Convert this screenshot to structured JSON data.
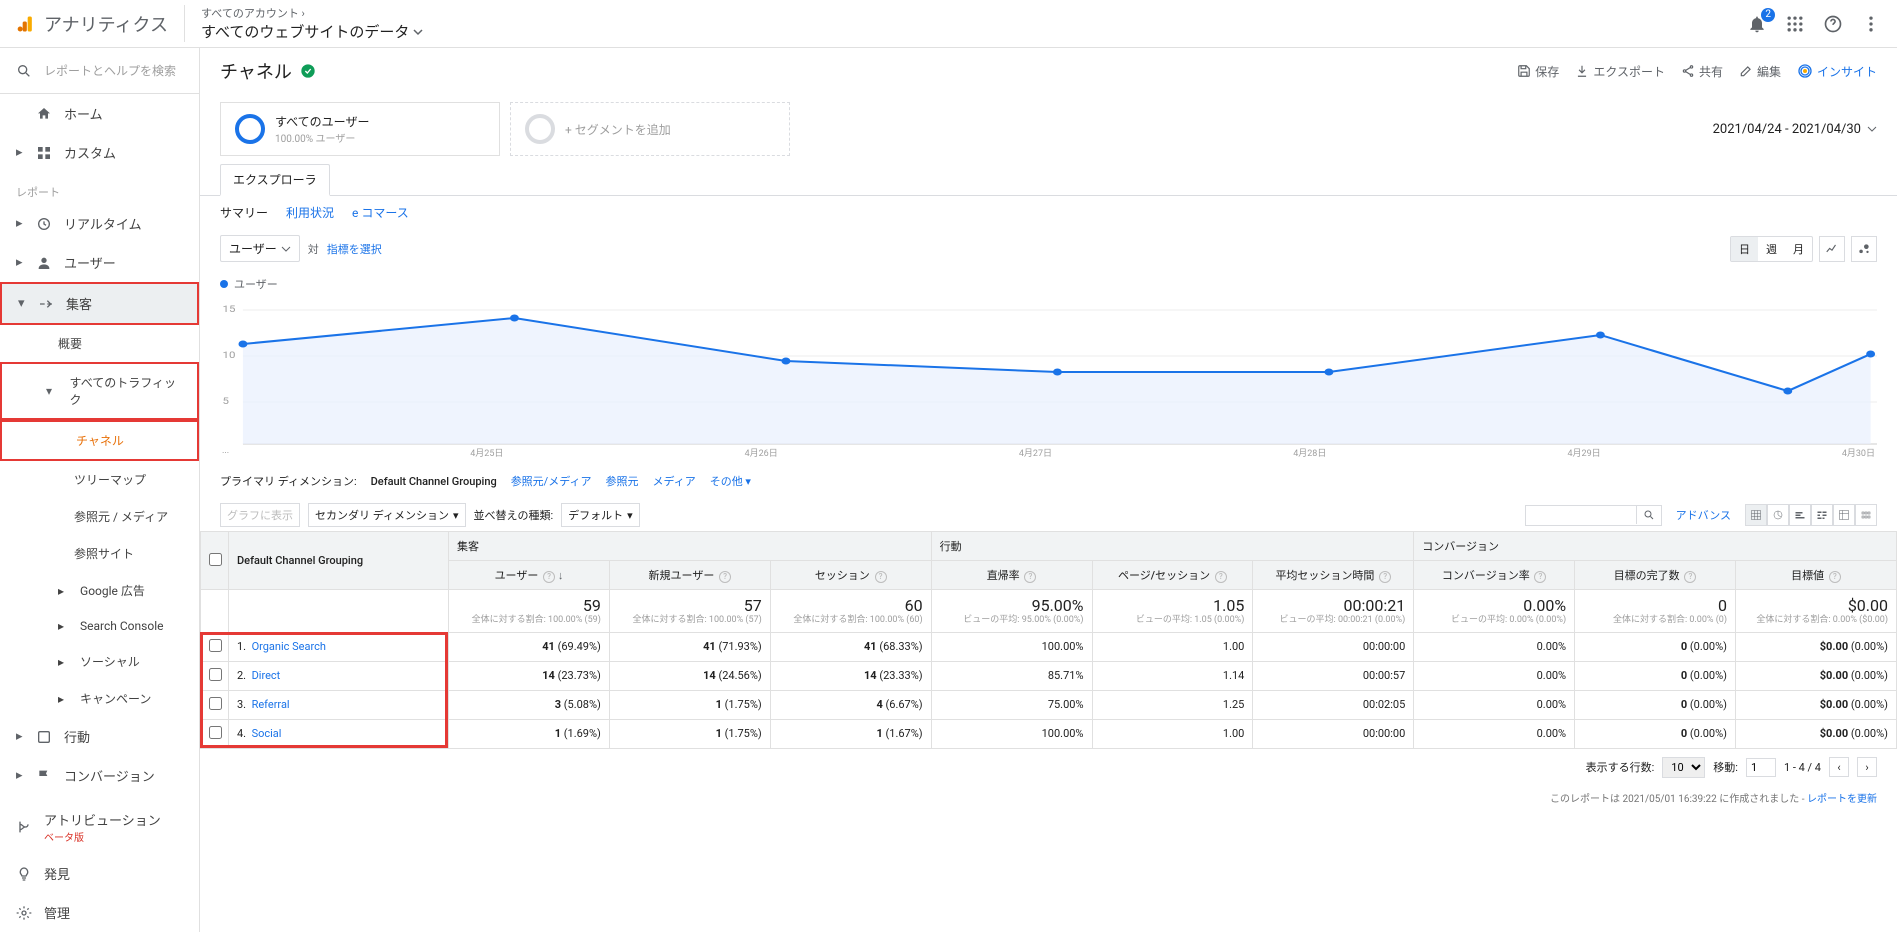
{
  "header": {
    "app_title": "アナリティクス",
    "account_path": "すべてのアカウント",
    "view_name": "すべてのウェブサイトのデータ",
    "badge": "2"
  },
  "sidebar": {
    "search_placeholder": "レポートとヘルプを検索",
    "home": "ホーム",
    "custom": "カスタム",
    "section_reports": "レポート",
    "realtime": "リアルタイム",
    "audience": "ユーザー",
    "acquisition": "集客",
    "acq_overview": "概要",
    "acq_all_traffic": "すべてのトラフィック",
    "channel": "チャネル",
    "treemap": "ツリーマップ",
    "source_medium": "参照元 / メディア",
    "referral": "参照サイト",
    "gads": "Google 広告",
    "sc": "Search Console",
    "social": "ソーシャル",
    "campaign": "キャンペーン",
    "behavior": "行動",
    "conversion": "コンバージョン",
    "attribution": "アトリビューション",
    "beta": "ベータ版",
    "discover": "発見",
    "admin": "管理"
  },
  "report": {
    "title": "チャネル",
    "save": "保存",
    "export": "エクスポート",
    "share": "共有",
    "edit": "編集",
    "insight": "インサイト",
    "seg_all_users": "すべてのユーザー",
    "seg_pct": "100.00% ユーザー",
    "seg_add": "+ セグメントを追加",
    "date_range": "2021/04/24 - 2021/04/30",
    "tab_explorer": "エクスプローラ",
    "subtabs": {
      "summary": "サマリー",
      "usage": "利用状況",
      "ecom": "e コマース"
    },
    "metric_btn": "ユーザー",
    "vs": "対",
    "metric_link": "指標を選択",
    "legend": "ユーザー",
    "time_toggles": {
      "day": "日",
      "week": "週",
      "month": "月"
    },
    "x_axis": [
      "...",
      "4月25日",
      "4月26日",
      "4月27日",
      "4月28日",
      "4月29日",
      "4月30日"
    ],
    "primary_dim_label": "プライマリ ディメンション:",
    "primary_dim_value": "Default Channel Grouping",
    "dim_links": {
      "sm": "参照元/メディア",
      "s": "参照元",
      "m": "メディア",
      "other": "その他"
    },
    "plot_in_chart": "グラフに表示",
    "secondary_dim": "セカンダリ ディメンション",
    "sort_label": "並べ替えの種類:",
    "sort_value": "デフォルト",
    "advanced": "アドバンス"
  },
  "chart_data": {
    "type": "line",
    "x": [
      "4/24",
      "4/25",
      "4/26",
      "4/27",
      "4/28",
      "4/29",
      "4/30"
    ],
    "series": [
      {
        "name": "ユーザー",
        "values": [
          11,
          14,
          9,
          8,
          8,
          12,
          6,
          10
        ]
      }
    ],
    "ylim": [
      0,
      15
    ],
    "y_ticks": [
      5,
      10,
      15
    ]
  },
  "table": {
    "col_group": {
      "dim": "Default Channel Grouping",
      "acq": "集客",
      "beh": "行動",
      "conv": "コンバージョン"
    },
    "cols": {
      "users": "ユーザー",
      "new_users": "新規ユーザー",
      "sessions": "セッション",
      "bounce": "直帰率",
      "pps": "ページ/セッション",
      "avg_dur": "平均セッション時間",
      "cvr": "コンバージョン率",
      "goal_comp": "目標の完了数",
      "goal_val": "目標値"
    },
    "totals": {
      "users": {
        "v": "59",
        "sub": "全体に対する割合: 100.00% (59)"
      },
      "new_users": {
        "v": "57",
        "sub": "全体に対する割合: 100.00% (57)"
      },
      "sessions": {
        "v": "60",
        "sub": "全体に対する割合: 100.00% (60)"
      },
      "bounce": {
        "v": "95.00%",
        "sub": "ビューの平均: 95.00% (0.00%)"
      },
      "pps": {
        "v": "1.05",
        "sub": "ビューの平均: 1.05 (0.00%)"
      },
      "avg_dur": {
        "v": "00:00:21",
        "sub": "ビューの平均: 00:00:21 (0.00%)"
      },
      "cvr": {
        "v": "0.00%",
        "sub": "ビューの平均: 0.00% (0.00%)"
      },
      "goal_comp": {
        "v": "0",
        "sub": "全体に対する割合: 0.00% (0)"
      },
      "goal_val": {
        "v": "$0.00",
        "sub": "全体に対する割合: 0.00% ($0.00)"
      }
    },
    "rows": [
      {
        "n": "1.",
        "name": "Organic Search",
        "users": "41",
        "users_p": "(69.49%)",
        "new": "41",
        "new_p": "(71.93%)",
        "sess": "41",
        "sess_p": "(68.33%)",
        "bounce": "100.00%",
        "pps": "1.00",
        "dur": "00:00:00",
        "cvr": "0.00%",
        "gc": "0",
        "gc_p": "(0.00%)",
        "gv": "$0.00",
        "gv_p": "(0.00%)"
      },
      {
        "n": "2.",
        "name": "Direct",
        "users": "14",
        "users_p": "(23.73%)",
        "new": "14",
        "new_p": "(24.56%)",
        "sess": "14",
        "sess_p": "(23.33%)",
        "bounce": "85.71%",
        "pps": "1.14",
        "dur": "00:00:57",
        "cvr": "0.00%",
        "gc": "0",
        "gc_p": "(0.00%)",
        "gv": "$0.00",
        "gv_p": "(0.00%)"
      },
      {
        "n": "3.",
        "name": "Referral",
        "users": "3",
        "users_p": "(5.08%)",
        "new": "1",
        "new_p": "(1.75%)",
        "sess": "4",
        "sess_p": "(6.67%)",
        "bounce": "75.00%",
        "pps": "1.25",
        "dur": "00:02:05",
        "cvr": "0.00%",
        "gc": "0",
        "gc_p": "(0.00%)",
        "gv": "$0.00",
        "gv_p": "(0.00%)"
      },
      {
        "n": "4.",
        "name": "Social",
        "users": "1",
        "users_p": "(1.69%)",
        "new": "1",
        "new_p": "(1.75%)",
        "sess": "1",
        "sess_p": "(1.67%)",
        "bounce": "100.00%",
        "pps": "1.00",
        "dur": "00:00:00",
        "cvr": "0.00%",
        "gc": "0",
        "gc_p": "(0.00%)",
        "gv": "$0.00",
        "gv_p": "(0.00%)"
      }
    ]
  },
  "pager": {
    "rows_label": "表示する行数:",
    "rows_val": "10",
    "goto_label": "移動:",
    "goto_val": "1",
    "range": "1 - 4 / 4"
  },
  "footer": {
    "text": "このレポートは 2021/05/01 16:39:22 に作成されました - ",
    "link": "レポートを更新"
  }
}
